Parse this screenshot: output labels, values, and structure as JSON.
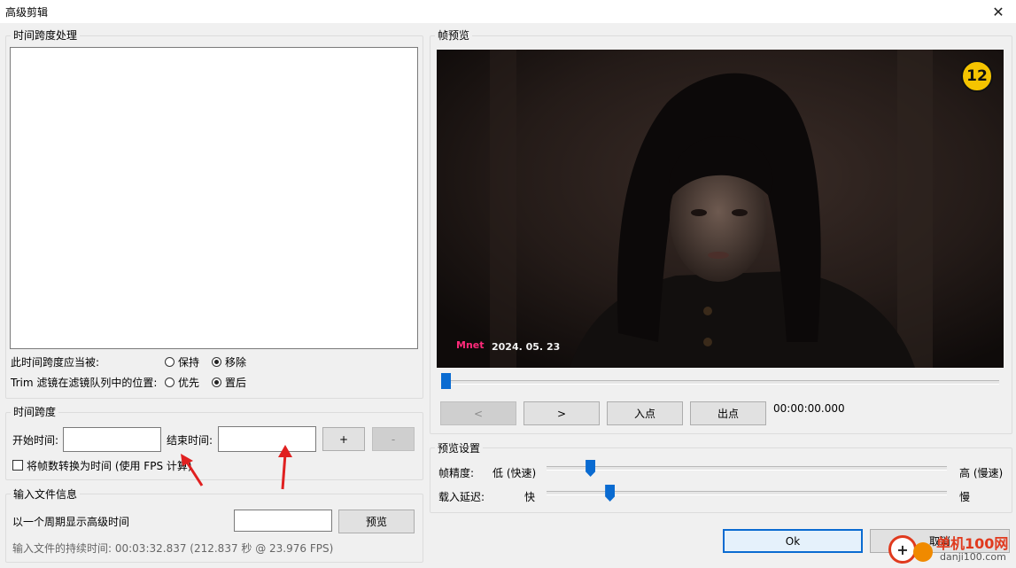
{
  "window": {
    "title": "高级剪辑",
    "close_glyph": "✕"
  },
  "time_range_processing": {
    "legend": "时间跨度处理",
    "should_be_label": "此时间跨度应当被:",
    "keep_label": "保持",
    "remove_label": "移除",
    "trim_position_label": "Trim 滤镜在滤镜队列中的位置:",
    "first_label": "优先",
    "last_label": "置后",
    "selected_action": "移除",
    "selected_position": "置后"
  },
  "time_range": {
    "legend": "时间跨度",
    "start_label": "开始时间:",
    "start_value": "",
    "end_label": "结束时间:",
    "end_value": "",
    "add_label": "+",
    "remove_label": "-",
    "convert_frames_label": "将帧数转换为时间 (使用 FPS 计算)"
  },
  "input_info": {
    "legend": "输入文件信息",
    "periodic_label": "以一个周期显示高级时间",
    "periodic_value": "",
    "preview_button": "预览",
    "duration_text": "输入文件的持续时间: 00:03:32.837 (212.837 秒 @ 23.976 FPS)"
  },
  "frame_preview": {
    "legend": "帧预览",
    "rating_badge": "12",
    "channel_logo": "Mnet",
    "date_overlay": "2024. 05. 23",
    "position_fraction": 0.0,
    "prev_label": "<",
    "next_label": ">",
    "in_point_label": "入点",
    "out_point_label": "出点",
    "timecode": "00:00:00.000"
  },
  "preview_settings": {
    "legend": "预览设置",
    "frame_precision_label": "帧精度:",
    "low_label": "低 (快速)",
    "high_label": "高 (慢速)",
    "frame_precision_fraction": 0.1,
    "load_delay_label": "载入延迟:",
    "fast_label": "快",
    "slow_label": "慢",
    "load_delay_fraction": 0.15
  },
  "footer": {
    "ok_label": "Ok",
    "cancel_label": "取消"
  },
  "watermark": {
    "text": "单机100网",
    "url_text": "danji100.com"
  },
  "colors": {
    "accent": "#0a6bd1",
    "arrow": "#e02020",
    "badge": "#f5c400"
  }
}
